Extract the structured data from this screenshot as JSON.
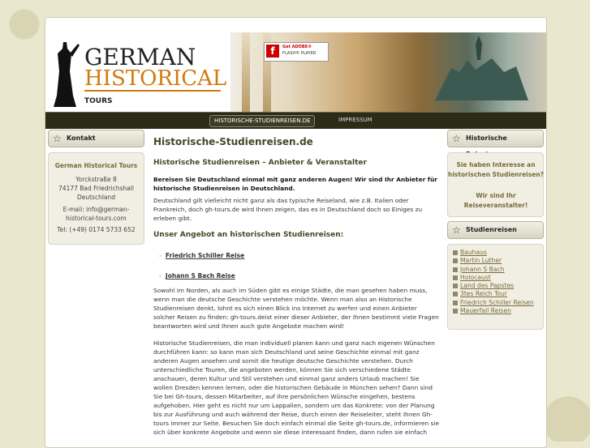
{
  "logo": {
    "line1": "GERMAN",
    "line2": "HISTORICAL",
    "line3": "TOURS"
  },
  "flash": {
    "line1": "Get ADOBE®",
    "line2": "FLASH® PLAYER"
  },
  "nav": {
    "items": [
      {
        "label": "HISTORISCHE-STUDIENREISEN.DE"
      },
      {
        "label": "IMPRESSUM"
      }
    ]
  },
  "left": {
    "title": "Kontakt",
    "company": "German Historical Tours",
    "street": "Yorckstraße 8",
    "city": "74177 Bad Friedrichshall",
    "country": "Deutschland",
    "email_line1": "E-mail: info@german-",
    "email_line2": "historical-tours.com",
    "phone": "Tel: (+49) 0174 5733 652"
  },
  "main": {
    "title": "Historische-Studienreisen.de",
    "subtitle": "Historische Studienreisen – Anbieter & Veranstalter",
    "intro": "Bereisen Sie Deutschland einmal mit ganz anderen Augen! Wir sind Ihr Anbieter für historische Studienreisen in Deutschland.",
    "para1": "Deutschland gilt vielleicht nicht ganz als das typische Reiseland, wie z.B. Italien oder Frankreich, doch gh-tours.de wird Ihnen zeigen, das es in Deutschland doch so Einiges zu erleben gibt.",
    "section": "Unser Angebot an historischen Studienreisen:",
    "links": [
      "Friedrich Schiller Reise",
      "Johann S Bach Reise"
    ],
    "para2": "Sowohl im Norden, als auch im Süden gibt es einige Städte, die man gesehen haben muss, wenn man die deutsche Geschichte verstehen möchte. Wenn man also an Historische Studienreisen denkt, lohnt es sich einen Blick ins Internet zu werfen und einen Anbieter solcher Reisen zu finden: gh-tours.deist einer dieser Anbieter, der Ihnen bestimmt viele Fragen beantworten wird und Ihnen auch gute Angebote machen wird!",
    "para3": "Historische Studienreisen, die man individuell planen kann und ganz nach eigenen Wünschen durchführen kann: so kann man sich Deutschland und seine Geschichte einmal mit ganz anderen Augen ansehen und somit die heutige deutsche Geschichte verstehen. Durch unterschiedliche Touren, die angeboten werden, können Sie sich verschiedene Städte anschauen, deren Kultur und Stil verstehen und einmal ganz anders Urlaub machen! Sie wollen Dresden kennen lernen, oder die historischen Gebäude in München sehen? Dann sind Sie bei Gh-tours, dessen Mitarbeiter, auf ihre persönlichen Wünsche eingehen, bestens aufgehoben. Hier geht es nicht nur um Lappalien, sondern um das Konkrete: von der Planung bis zur Ausführung und auch während der Reise, durch einen der Reiseleiter, steht Ihnen Gh-tours immer zur Seite. Besuchen Sie doch einfach einmal die Seite gh-tours.de, informieren sie sich über konkrete Angebote und wenn sie diese interessant finden, dann rufen sie einfach"
  },
  "right": {
    "box1_title": "Historische Reisetouren",
    "q1": "Sie haben Interesse an historischen Studienreisen?",
    "q2": "Wir sind Ihr Reiseveranstalter!",
    "box2_title": "Studienreisen",
    "items": [
      "Bauhaus",
      "Martin Luther",
      "Johann S Bach",
      "Holocaust",
      "Land des Papstes",
      "3tes Reich Tour",
      "Friedrich Schiller Reisen",
      "Mauerfall Reisen"
    ]
  }
}
